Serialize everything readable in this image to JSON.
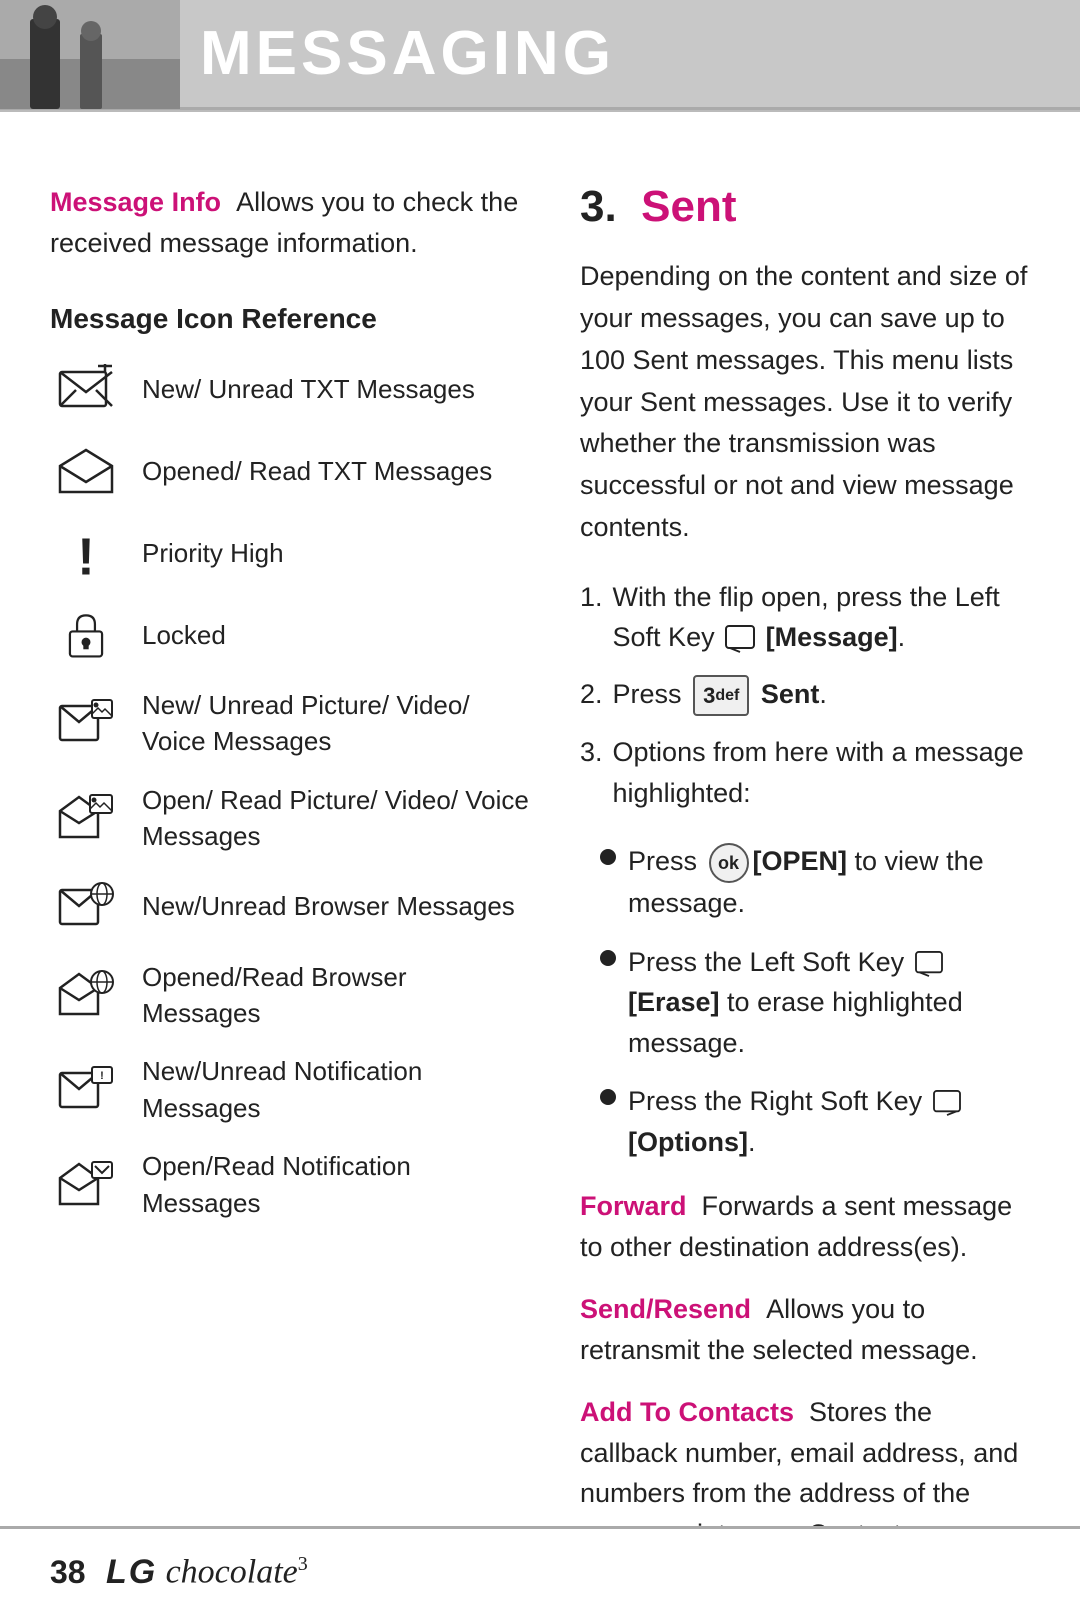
{
  "header": {
    "title": "MESSAGING"
  },
  "left_column": {
    "message_info": {
      "label": "Message Info",
      "text": "Allows you to check the received message information."
    },
    "icon_reference_heading": "Message Icon Reference",
    "icons": [
      {
        "id": "new-unread-txt",
        "label": "New/ Unread TXT Messages",
        "icon_type": "envelope_new"
      },
      {
        "id": "opened-read-txt",
        "label": "Opened/ Read TXT Messages",
        "icon_type": "envelope_open"
      },
      {
        "id": "priority-high",
        "label": "Priority High",
        "icon_type": "priority"
      },
      {
        "id": "locked",
        "label": "Locked",
        "icon_type": "lock"
      },
      {
        "id": "new-unread-picture",
        "label": "New/ Unread Picture/ Video/ Voice Messages",
        "icon_type": "envelope_picture_new"
      },
      {
        "id": "open-read-picture",
        "label": "Open/ Read Picture/ Video/ Voice Messages",
        "icon_type": "envelope_picture_open"
      },
      {
        "id": "new-unread-browser",
        "label": "New/Unread Browser Messages",
        "icon_type": "envelope_browser_new"
      },
      {
        "id": "opened-read-browser",
        "label": "Opened/Read Browser Messages",
        "icon_type": "envelope_browser_open"
      },
      {
        "id": "new-unread-notification",
        "label": "New/Unread Notification Messages",
        "icon_type": "envelope_notification_new"
      },
      {
        "id": "open-read-notification",
        "label": "Open/Read Notification Messages",
        "icon_type": "envelope_notification_open"
      }
    ]
  },
  "right_column": {
    "section_number": "3.",
    "section_title": "Sent",
    "intro_text": "Depending on the content and size of your messages, you can save up to 100 Sent messages. This menu lists your Sent messages. Use it to verify whether the transmission was successful or not and view message contents.",
    "steps": [
      {
        "number": "1.",
        "text": "With the flip open, press the Left Soft Key",
        "key": "",
        "key_label": "[Message]",
        "has_key_badge": true,
        "key_badge_text": ""
      },
      {
        "number": "2.",
        "text": "Press",
        "key_badge": "3",
        "key_badge_sup": "def",
        "bold_text": "Sent",
        "has_key_badge": true
      },
      {
        "number": "3.",
        "text": "Options from here with a message highlighted:",
        "has_key_badge": false
      }
    ],
    "bullets": [
      {
        "text_before": "Press",
        "key_icon": "ok",
        "bold_text": "[OPEN]",
        "text_after": "to view the message."
      },
      {
        "text_before": "Press the Left Soft Key",
        "key_icon": "left_soft",
        "bold_text": "[Erase]",
        "text_after": "to erase highlighted message."
      },
      {
        "text_before": "Press the Right Soft Key",
        "key_icon": "right_soft",
        "bold_text": "[Options]",
        "text_after": "."
      }
    ],
    "info_blocks": [
      {
        "label": "Forward",
        "label_color": "pink",
        "text": "Forwards a sent message to other destination address(es)."
      },
      {
        "label": "Send/Resend",
        "label_color": "pink",
        "text": "Allows you to retransmit the selected message."
      },
      {
        "label": "Add To Contacts",
        "label_color": "pink",
        "text": "Stores the callback number, email address, and numbers from the address of the message into your Contacts."
      }
    ]
  },
  "footer": {
    "page_number": "38",
    "brand_lg": "LG",
    "brand_product": "chocolate",
    "brand_superscript": "3"
  }
}
